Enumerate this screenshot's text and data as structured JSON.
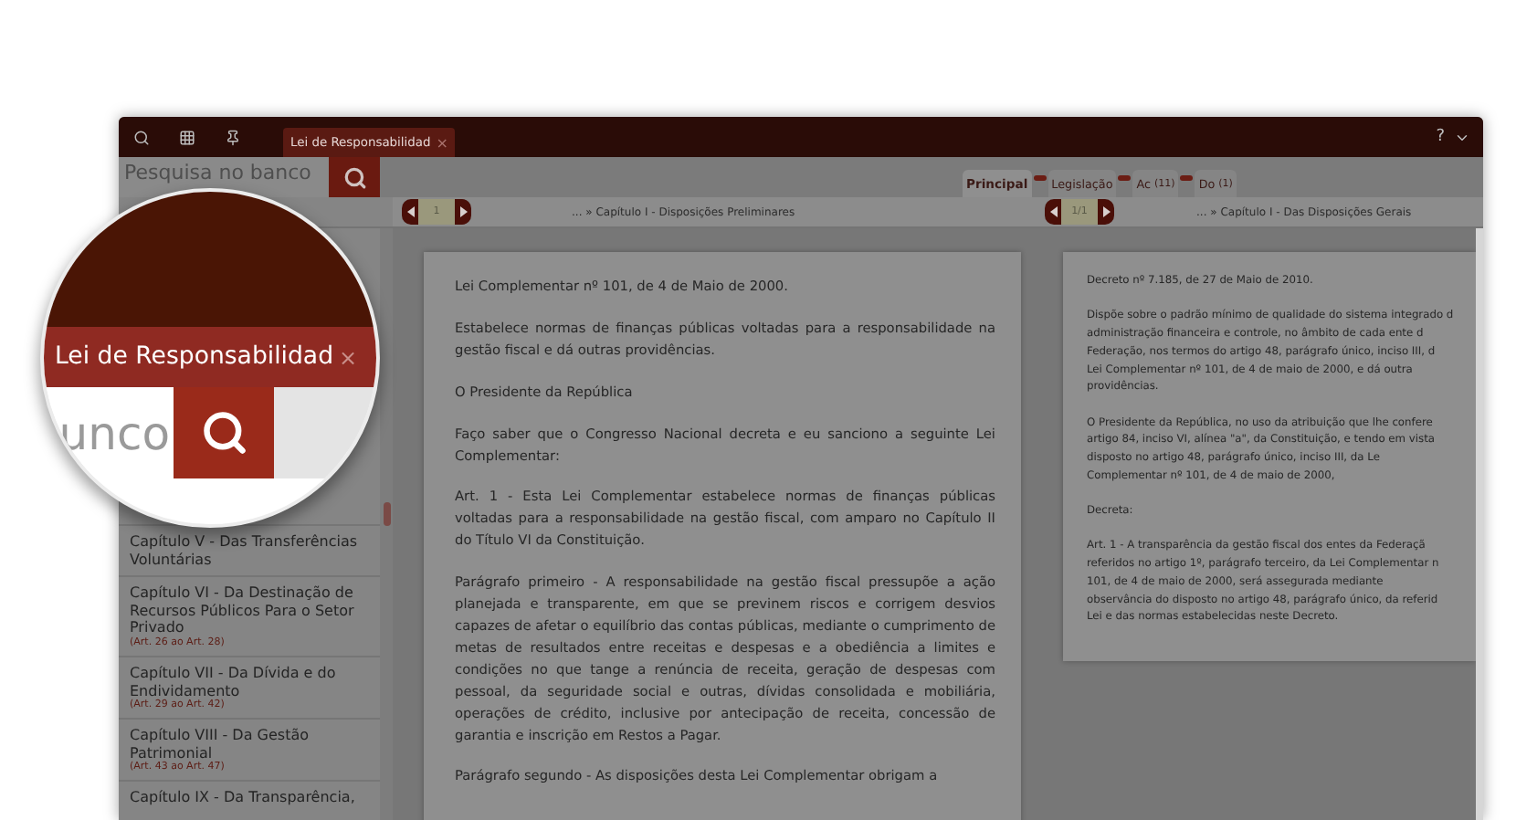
{
  "toolbar": {
    "tab": {
      "label": "Lei de Responsabilidad",
      "close": "×",
      "selected": true
    },
    "help": "?"
  },
  "search": {
    "placeholder": "Pesquisa no banco"
  },
  "view_tabs": [
    {
      "label": "Principal",
      "selected": true
    },
    {
      "label": "Legislação",
      "selected": false
    },
    {
      "label": "Ac",
      "count": "(11)",
      "selected": false
    },
    {
      "label": "Do",
      "count": "(1)",
      "selected": false
    }
  ],
  "sidebar": {
    "items": [
      {
        "title": "Capítulo V - Das Transferências Voluntárias"
      },
      {
        "title": "Capítulo VI - Da Destinação de Recursos Públicos Para o Setor Privado",
        "range": "(Art. 26 ao Art. 28)"
      },
      {
        "title": "Capítulo VII - Da Dívida e do Endividamento",
        "range": "(Art. 29 ao Art. 42)"
      },
      {
        "title": "Capítulo VIII - Da Gestão Patrimonial",
        "range": "(Art. 43 ao Art. 47)"
      },
      {
        "title": "Capítulo IX - Da Transparência,"
      }
    ]
  },
  "left_pane": {
    "page": "1",
    "breadcrumb": "... » Capítulo I - Disposições Preliminares",
    "paragraphs": [
      "Lei Complementar nº 101, de 4 de Maio de 2000.",
      "Estabelece normas de finanças públicas voltadas para a responsabilidade na gestão fiscal e dá outras providências.",
      "O Presidente da República",
      "Faço saber que o Congresso Nacional decreta e eu sanciono a seguinte Lei Complementar:",
      "Art. 1 - Esta Lei Complementar estabelece normas de finanças públicas voltadas para a responsabilidade na gestão fiscal, com amparo no Capítulo II do Título VI da Constituição.",
      "Parágrafo primeiro - A responsabilidade na gestão fiscal pressupõe a ação planejada e transparente, em que se previnem riscos e corrigem desvios capazes de afetar o equilíbrio das contas públicas, mediante o cumprimento de metas de resultados entre receitas e despesas e a obediência a limites e condições no que tange a renúncia de receita, geração de despesas com pessoal, da seguridade social e outras, dívidas consolidada e mobiliária, operações de crédito, inclusive por antecipação de receita, concessão de garantia e inscrição em Restos a Pagar.",
      "Parágrafo segundo - As disposições desta Lei Complementar obrigam a"
    ]
  },
  "right_pane": {
    "page": "1/1",
    "breadcrumb": "... » Capítulo I - Das Disposições Gerais",
    "paragraphs": [
      [
        "Decreto nº 7.185, de 27 de Maio de 2010."
      ],
      [
        "Dispõe sobre o padrão mínimo de qualidade do sistema integrado d",
        "administração financeira e controle, no âmbito de cada ente d",
        "Federação, nos termos do artigo 48, parágrafo único, inciso III, d",
        "Lei Complementar nº 101, de 4 de maio de 2000, e dá outra",
        "providências."
      ],
      [
        "O Presidente da República, no uso da atribuição que lhe confere",
        "artigo 84, inciso VI, alínea \"a\", da Constituição, e tendo em vista",
        "disposto no artigo 48, parágrafo único, inciso III, da Le",
        "Complementar nº 101, de 4 de maio de 2000,"
      ],
      [
        "Decreta:"
      ],
      [
        "Art. 1 - A transparência da gestão fiscal dos entes da Federaçã",
        "referidos no artigo 1º, parágrafo terceiro, da Lei Complementar n",
        "101, de 4 de maio de 2000, será assegurada mediante",
        "observância do disposto no artigo 48, parágrafo único, da referid",
        "Lei e das normas estabelecidas neste Decreto."
      ]
    ]
  },
  "magnifier": {
    "tab_label": "Lei de Responsabilidad",
    "tab_close": "×",
    "search_text": "unco"
  }
}
